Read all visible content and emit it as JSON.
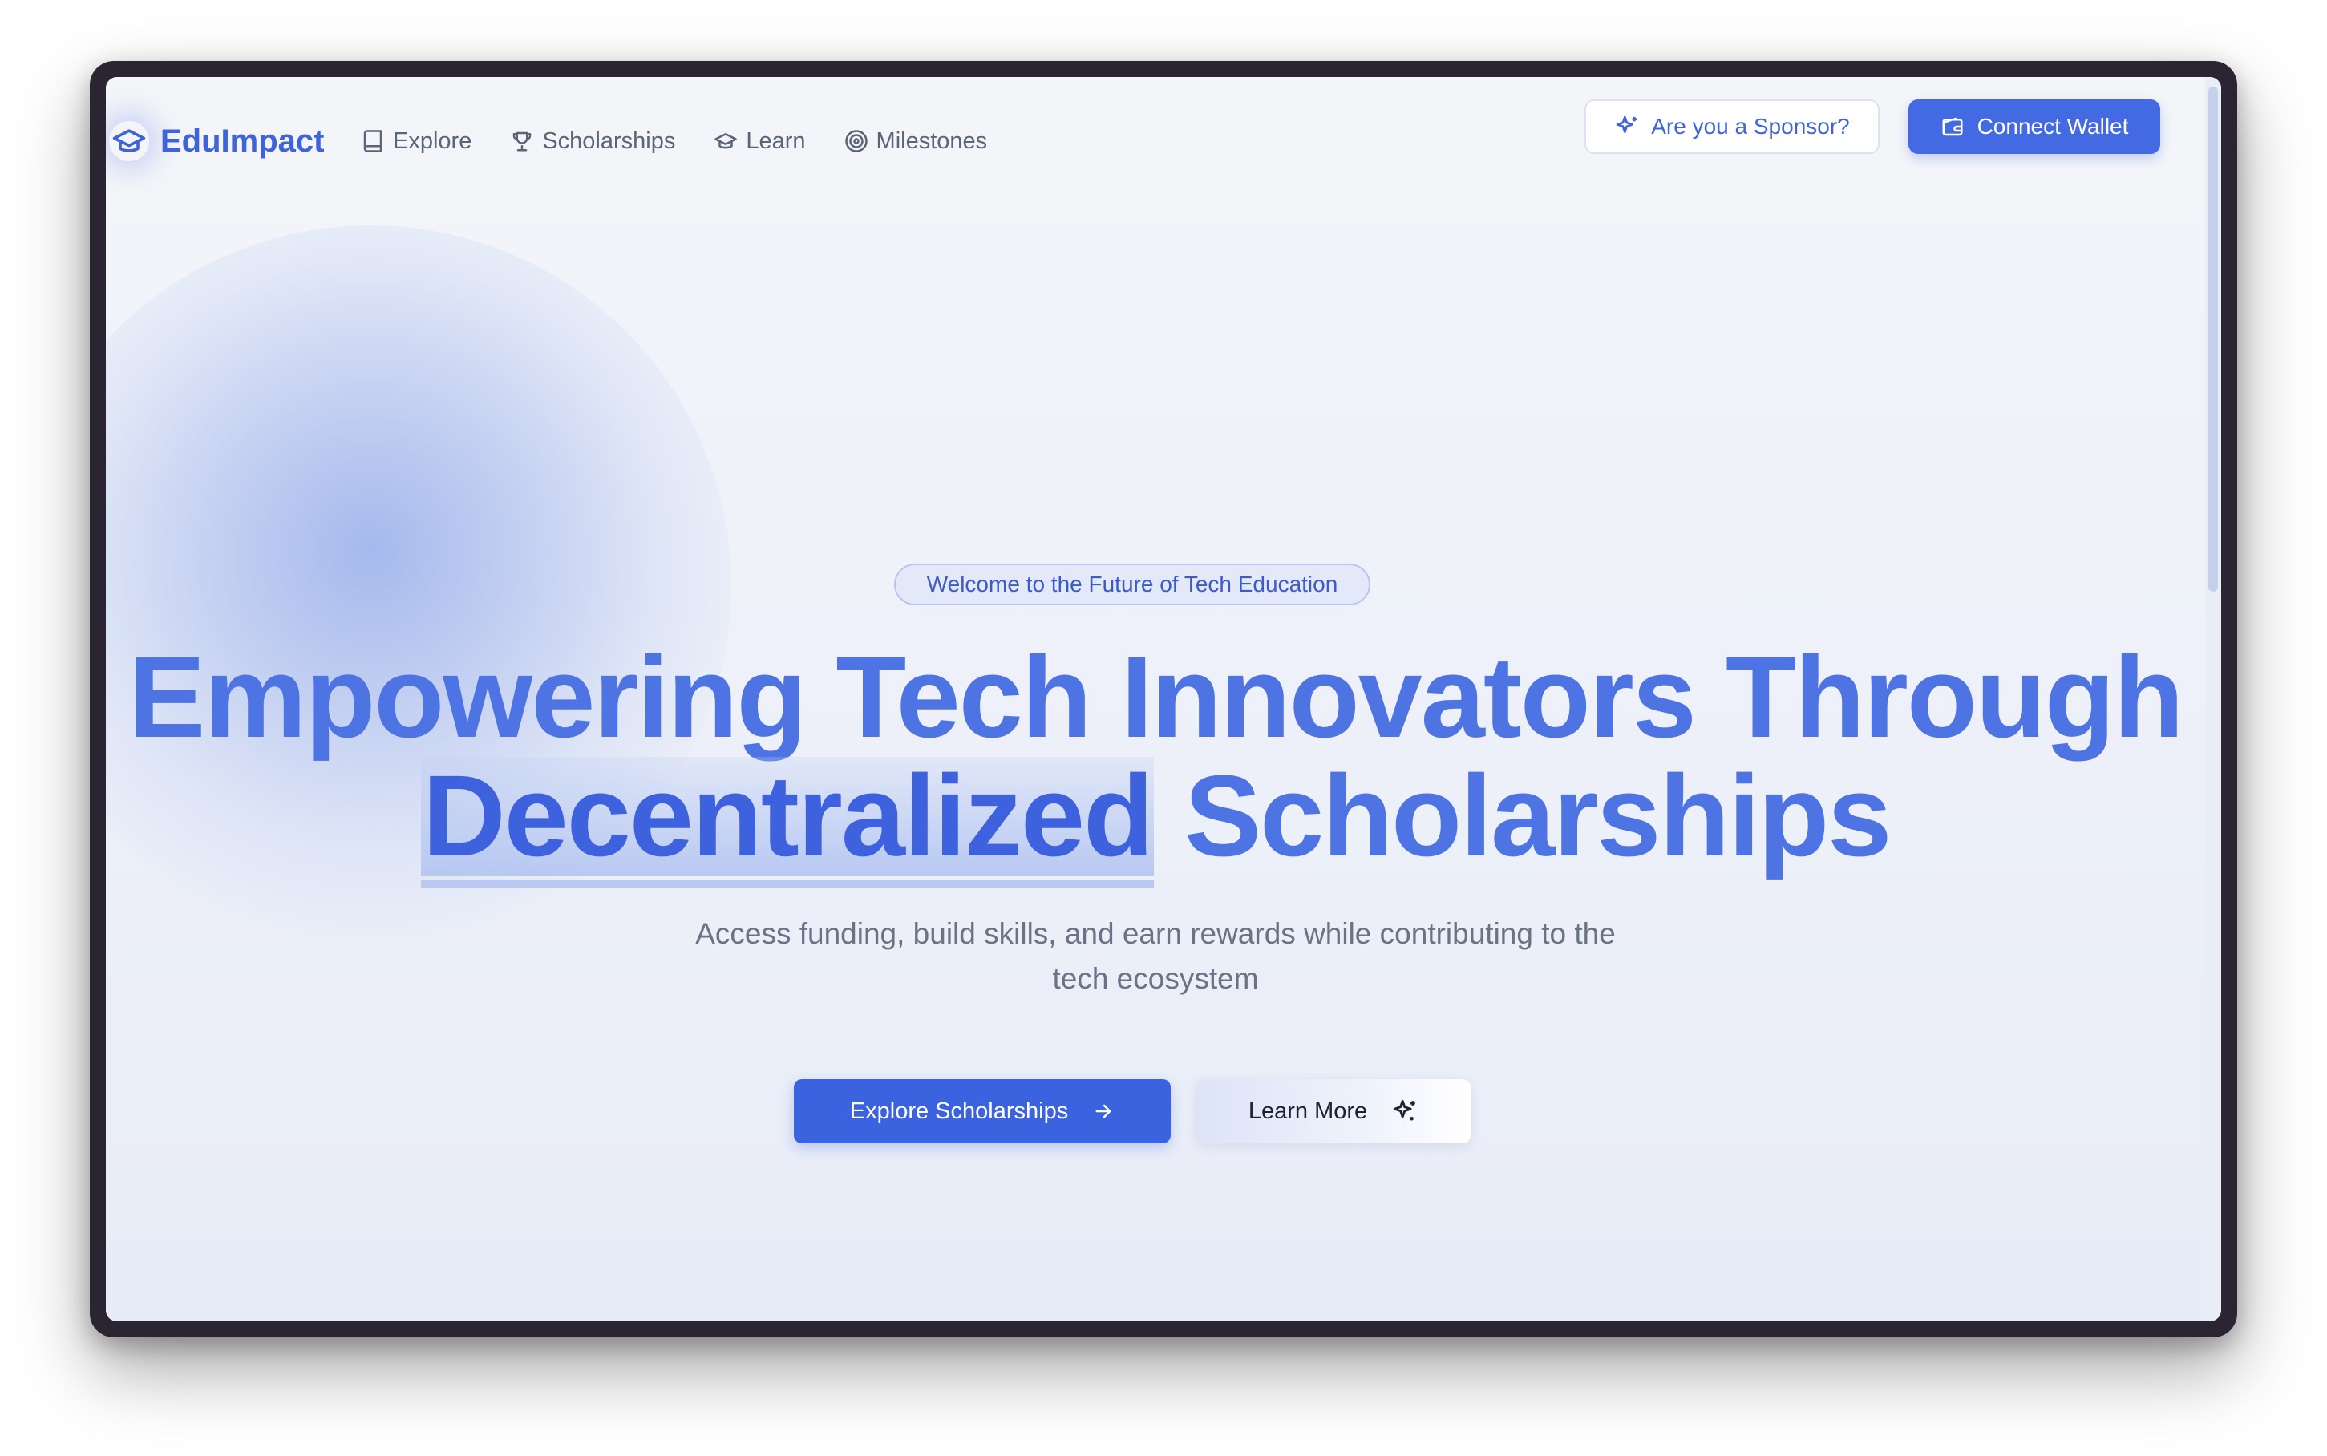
{
  "brand": {
    "name": "EduImpact",
    "icon": "graduation-cap-icon"
  },
  "nav": {
    "items": [
      {
        "label": "Explore",
        "icon": "book-icon"
      },
      {
        "label": "Scholarships",
        "icon": "trophy-icon"
      },
      {
        "label": "Learn",
        "icon": "graduation-cap-icon"
      },
      {
        "label": "Milestones",
        "icon": "target-icon"
      }
    ],
    "sponsor_label": "Are you a Sponsor?",
    "wallet_label": "Connect Wallet"
  },
  "hero": {
    "badge": "Welcome to the Future of Tech Education",
    "headline_line1": "Empowering Tech Innovators Through",
    "headline_highlight": "Decentralized",
    "headline_line2_rest": "Scholarships",
    "subtitle": "Access funding, build skills, and earn rewards while contributing to the tech ecosystem",
    "primary_cta": "Explore Scholarships",
    "secondary_cta": "Learn More"
  },
  "colors": {
    "accent": "#4369e3",
    "headline": "#4e74e3",
    "text_muted": "#6a7385",
    "frame": "#2a2433"
  }
}
